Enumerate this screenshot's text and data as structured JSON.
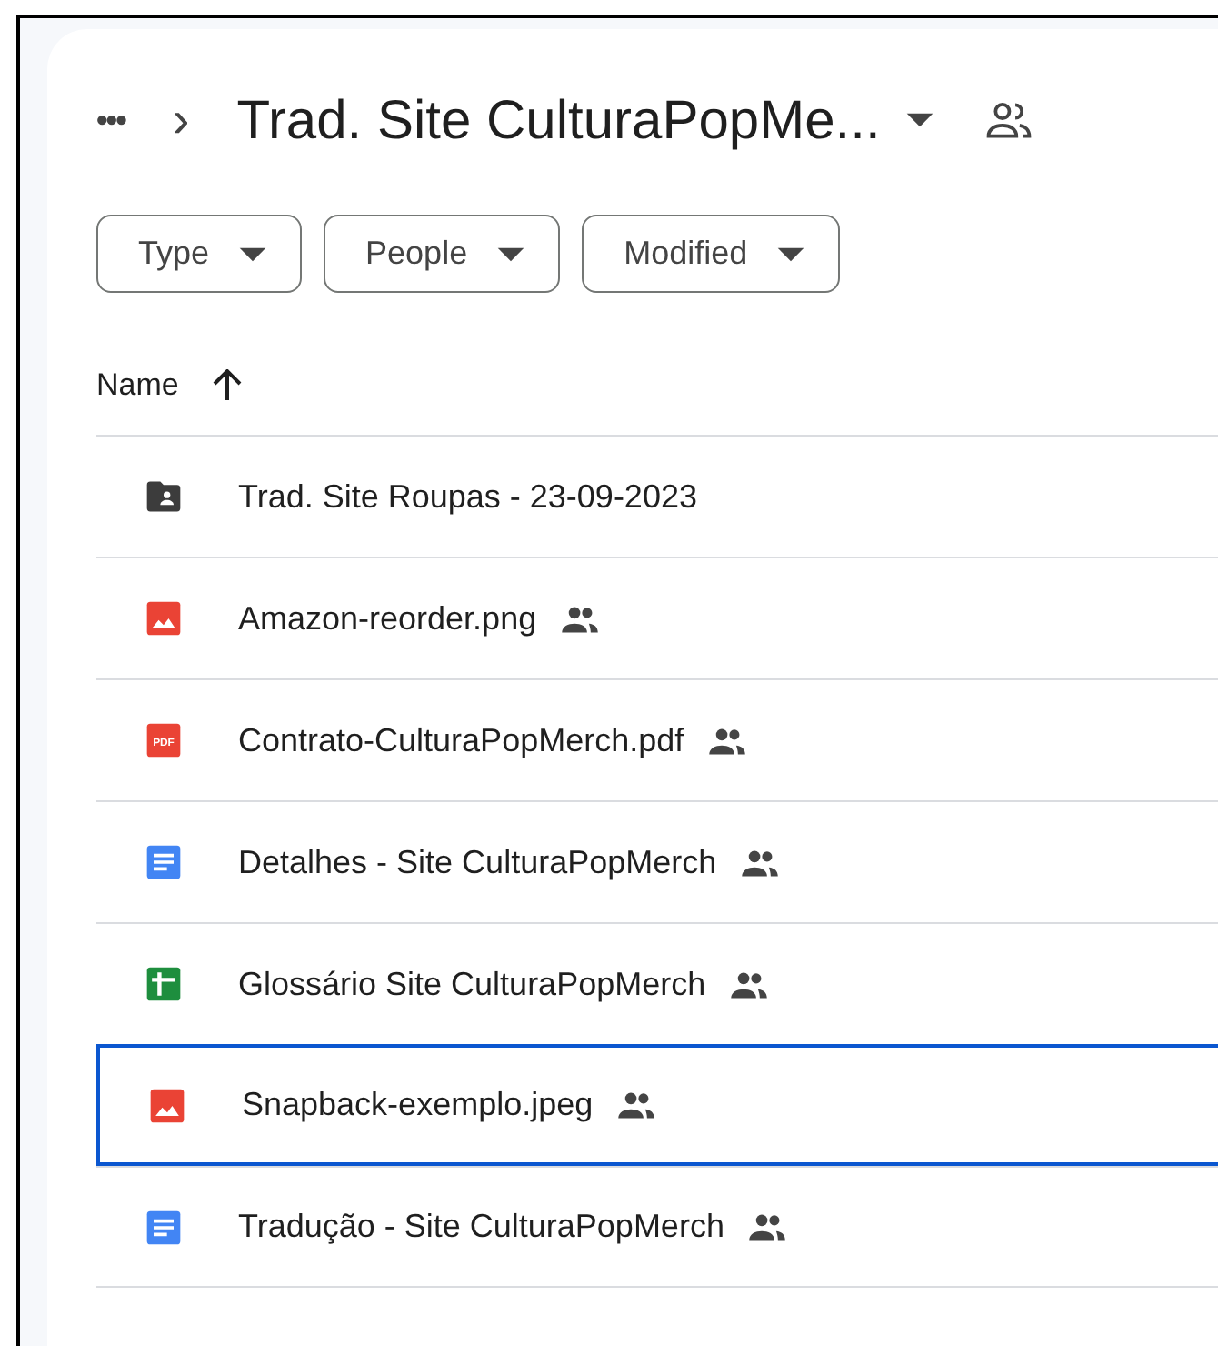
{
  "breadcrumb": {
    "more": "•••",
    "separator": "›",
    "title": "Trad. Site CulturaPopMe...",
    "shared": true
  },
  "filters": [
    {
      "label": "Type"
    },
    {
      "label": "People"
    },
    {
      "label": "Modified"
    }
  ],
  "table": {
    "columns": [
      {
        "label": "Name",
        "sort_ascending": true
      }
    ],
    "rows": [
      {
        "name": "Trad. Site Roupas - 23-09-2023",
        "kind": "folder",
        "shared": false,
        "selected": false
      },
      {
        "name": "Amazon-reorder.png",
        "kind": "image",
        "shared": true,
        "selected": false
      },
      {
        "name": "Contrato-CulturaPopMerch.pdf",
        "kind": "pdf",
        "icon_text": "PDF",
        "shared": true,
        "selected": false
      },
      {
        "name": "Detalhes - Site CulturaPopMerch",
        "kind": "doc",
        "shared": true,
        "selected": false
      },
      {
        "name": "Glossário Site CulturaPopMerch",
        "kind": "sheet",
        "shared": true,
        "selected": false
      },
      {
        "name": "Snapback-exemplo.jpeg",
        "kind": "image",
        "shared": true,
        "selected": true
      },
      {
        "name": "Tradução - Site CulturaPopMerch",
        "kind": "doc",
        "shared": true,
        "selected": false
      }
    ]
  }
}
